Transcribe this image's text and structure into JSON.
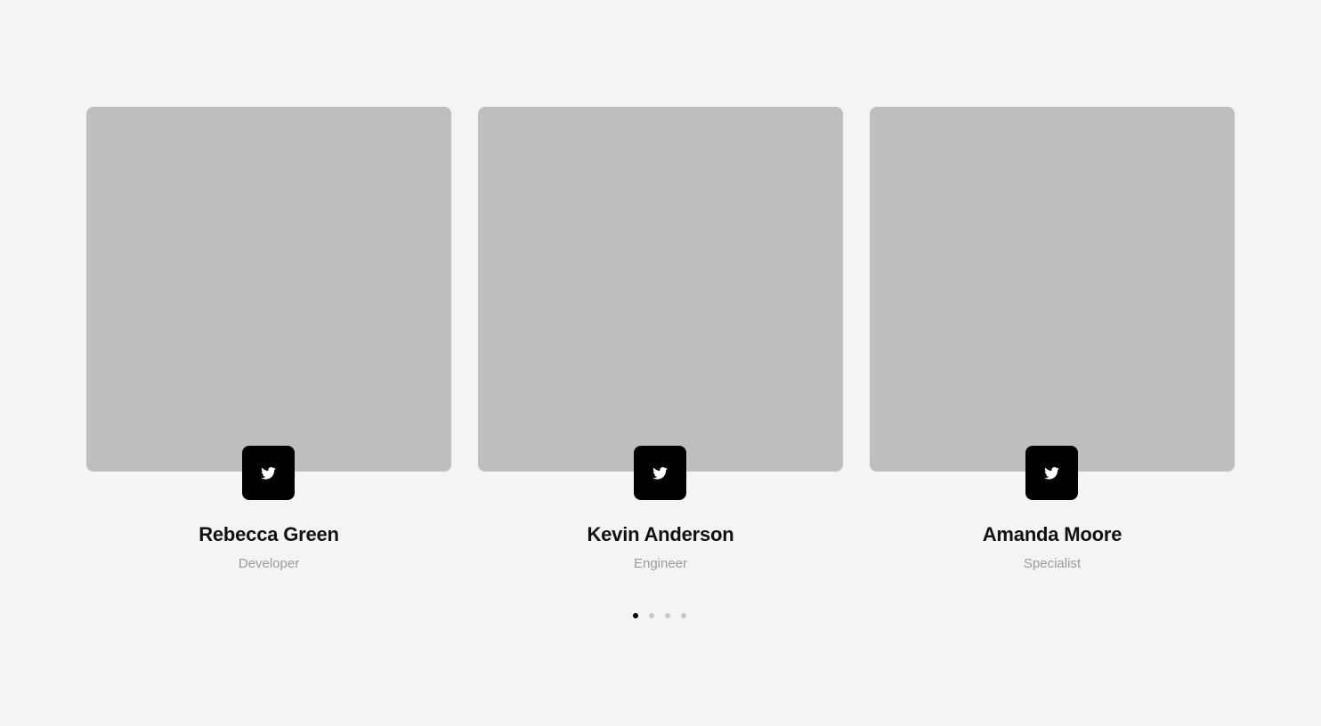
{
  "members": [
    {
      "name": "Rebecca Green",
      "role": "Developer",
      "social_icon": "twitter-icon"
    },
    {
      "name": "Kevin Anderson",
      "role": "Engineer",
      "social_icon": "twitter-icon"
    },
    {
      "name": "Amanda Moore",
      "role": "Specialist",
      "social_icon": "twitter-icon"
    }
  ],
  "pagination": {
    "total_pages": 4,
    "active_page": 1
  },
  "colors": {
    "background": "#f4f4f4",
    "photo_placeholder": "#bdbec0",
    "social_button": "#000000",
    "name_text": "#111111",
    "role_text": "#9a9a9a",
    "dot_active": "#000000",
    "dot_inactive": "#c8c8c8"
  }
}
